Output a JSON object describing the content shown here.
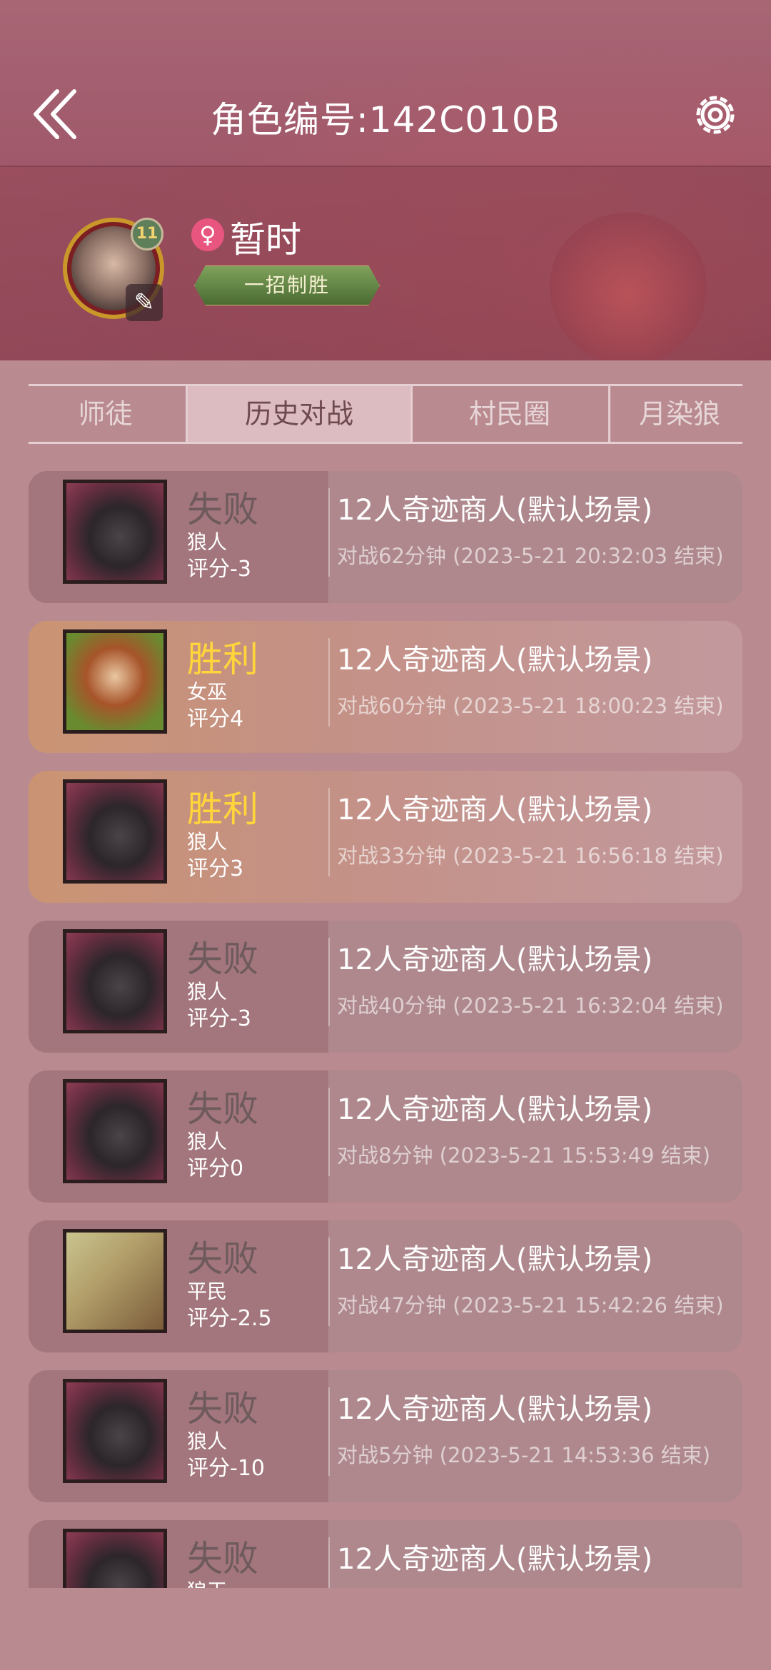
{
  "header": {
    "title": "角色编号:142C010B"
  },
  "profile": {
    "level": "11",
    "username": "暂时",
    "gender": "female",
    "title_badge": "一招制胜"
  },
  "tabs": [
    {
      "label": "师徒",
      "active": false
    },
    {
      "label": "历史对战",
      "active": true
    },
    {
      "label": "村民圈",
      "active": false
    },
    {
      "label": "月染狼",
      "active": false
    }
  ],
  "matches": [
    {
      "result": "失败",
      "win": false,
      "role": "狼人",
      "score": "评分-3",
      "mode": "12人奇迹商人(默认场景)",
      "meta": "对战62分钟 (2023-5-21 20:32:03 结束)",
      "portrait": "werewolf"
    },
    {
      "result": "胜利",
      "win": true,
      "role": "女巫",
      "score": "评分4",
      "mode": "12人奇迹商人(默认场景)",
      "meta": "对战60分钟 (2023-5-21 18:00:23 结束)",
      "portrait": "witch"
    },
    {
      "result": "胜利",
      "win": true,
      "role": "狼人",
      "score": "评分3",
      "mode": "12人奇迹商人(默认场景)",
      "meta": "对战33分钟 (2023-5-21 16:56:18 结束)",
      "portrait": "werewolf"
    },
    {
      "result": "失败",
      "win": false,
      "role": "狼人",
      "score": "评分-3",
      "mode": "12人奇迹商人(默认场景)",
      "meta": "对战40分钟 (2023-5-21 16:32:04 结束)",
      "portrait": "werewolf"
    },
    {
      "result": "失败",
      "win": false,
      "role": "狼人",
      "score": "评分0",
      "mode": "12人奇迹商人(默认场景)",
      "meta": "对战8分钟 (2023-5-21 15:53:49 结束)",
      "portrait": "werewolf"
    },
    {
      "result": "失败",
      "win": false,
      "role": "平民",
      "score": "评分-2.5",
      "mode": "12人奇迹商人(默认场景)",
      "meta": "对战47分钟 (2023-5-21 15:42:26 结束)",
      "portrait": "villager"
    },
    {
      "result": "失败",
      "win": false,
      "role": "狼人",
      "score": "评分-10",
      "mode": "12人奇迹商人(默认场景)",
      "meta": "对战5分钟 (2023-5-21 14:53:36 结束)",
      "portrait": "werewolf"
    },
    {
      "result": "失败",
      "win": false,
      "role": "狼王",
      "score": "",
      "mode": "12人奇迹商人(默认场景)",
      "meta": "",
      "portrait": "wolf-king"
    }
  ],
  "icons": {
    "back": "double-chevron-left-icon",
    "settings": "gear-icon",
    "edit": "edit-icon",
    "gender": "female-icon"
  },
  "colors": {
    "win_text": "#ffd53b",
    "lose_text": "#6e5a5c",
    "gender_badge": "#e8557f",
    "title_badge": "#5e8040"
  }
}
